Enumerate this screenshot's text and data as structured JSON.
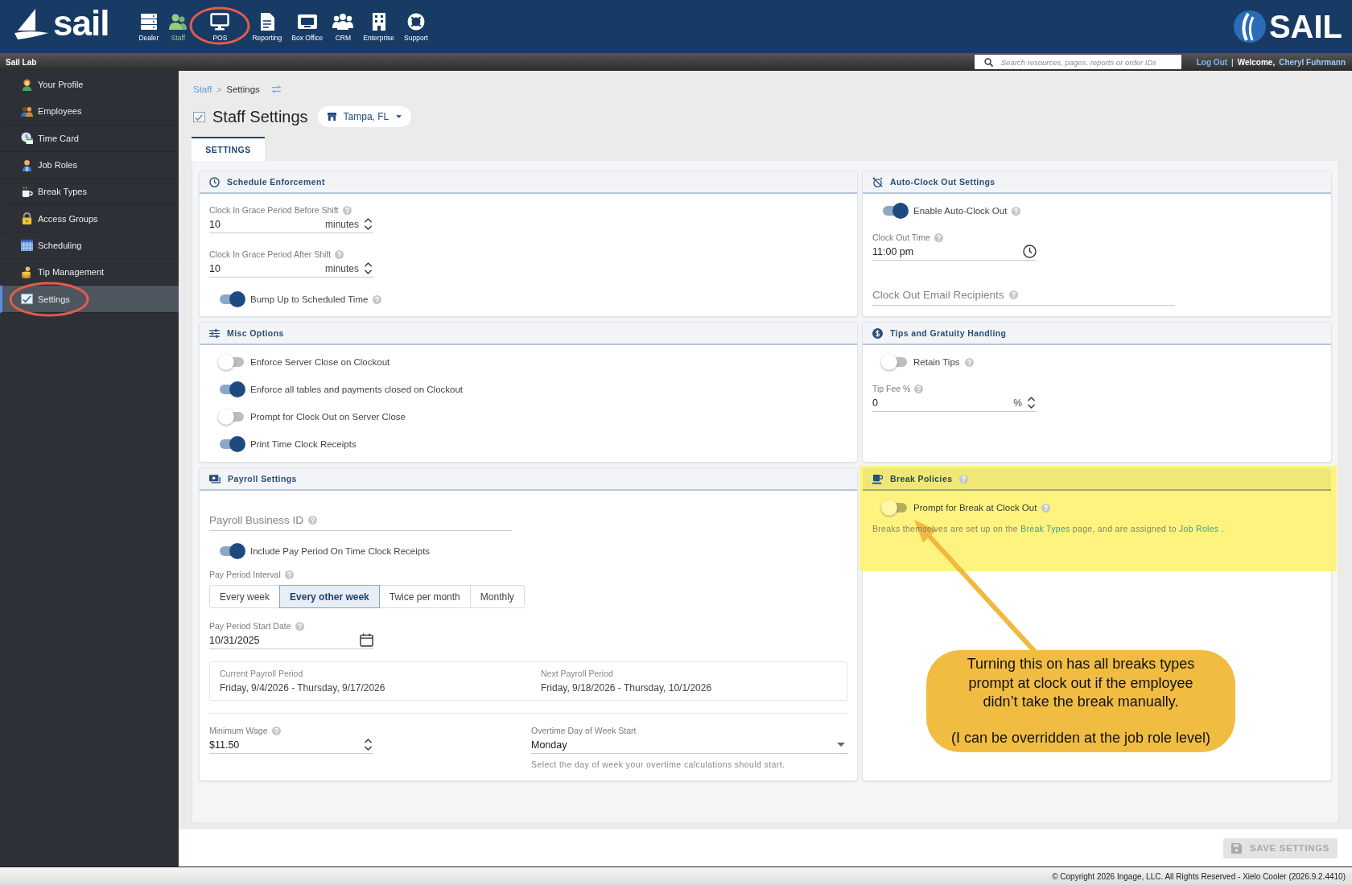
{
  "header": {
    "logo": "sail",
    "nav": [
      {
        "label": "Dealer",
        "selected": false,
        "circled": false
      },
      {
        "label": "Staff",
        "selected": true,
        "circled": false
      },
      {
        "label": "POS",
        "selected": false,
        "circled": true
      },
      {
        "label": "Reporting",
        "selected": false,
        "circled": false
      },
      {
        "label": "Box Office",
        "selected": false,
        "circled": false
      },
      {
        "label": "CRM",
        "selected": false,
        "circled": false
      },
      {
        "label": "Enterprise",
        "selected": false,
        "circled": false
      },
      {
        "label": "Support",
        "selected": false,
        "circled": false
      }
    ],
    "brand": "SAIL"
  },
  "toolbar": {
    "site": "Sail Lab",
    "search": {
      "placeholder": "Search resources, pages, reports or order IDs"
    },
    "logout": "Log Out",
    "separator": "|",
    "welcome": "Welcome,",
    "user": "Cheryl Fuhrmann"
  },
  "sidebar": {
    "items": [
      {
        "label": "Your Profile",
        "selected": false,
        "circled": false
      },
      {
        "label": "Employees",
        "selected": false,
        "circled": false
      },
      {
        "label": "Time Card",
        "selected": false,
        "circled": false
      },
      {
        "label": "Job Roles",
        "selected": false,
        "circled": false
      },
      {
        "label": "Break Types",
        "selected": false,
        "circled": false
      },
      {
        "label": "Access Groups",
        "selected": false,
        "circled": false
      },
      {
        "label": "Scheduling",
        "selected": false,
        "circled": false
      },
      {
        "label": "Tip Management",
        "selected": false,
        "circled": false
      },
      {
        "label": "Settings",
        "selected": true,
        "circled": true
      }
    ]
  },
  "breadcrumb": {
    "items": [
      {
        "label": "Staff",
        "link": true
      },
      {
        "label": "Settings",
        "link": false
      }
    ],
    "separator": ">"
  },
  "page": {
    "title": "Staff Settings",
    "location": "Tampa, FL"
  },
  "tabs": [
    {
      "label": "SETTINGS",
      "selected": true
    }
  ],
  "panels": [
    {
      "title": "Schedule Enforcement",
      "help": false,
      "highlighted": false,
      "rows": [
        {
          "kind": "number",
          "label": "Clock In Grace Period Before Shift",
          "help": true,
          "value": "10",
          "unit": "minutes"
        },
        {
          "kind": "number",
          "label": "Clock In Grace Period After Shift",
          "help": true,
          "value": "10",
          "unit": "minutes"
        },
        {
          "kind": "toggle",
          "label": "Bump Up to Scheduled Time",
          "help": true,
          "on": true
        }
      ]
    },
    {
      "title": "Auto-Clock Out Settings",
      "help": false,
      "highlighted": false,
      "rows": [
        {
          "kind": "toggle",
          "label": "Enable Auto-Clock Out",
          "help": true,
          "on": true
        },
        {
          "kind": "time",
          "label": "Clock Out Time",
          "help": true,
          "value": "11:00 pm"
        },
        {
          "kind": "empty",
          "placeholder": "Clock Out Email Recipients",
          "help": true
        }
      ]
    },
    {
      "title": "Misc Options",
      "help": false,
      "highlighted": false,
      "rows": [
        {
          "kind": "toggle",
          "label": "Enforce Server Close on Clockout",
          "help": false,
          "on": false
        },
        {
          "kind": "toggle",
          "label": "Enforce all tables and payments closed on Clockout",
          "help": false,
          "on": true
        },
        {
          "kind": "toggle",
          "label": "Prompt for Clock Out on Server Close",
          "help": false,
          "on": false
        },
        {
          "kind": "toggle",
          "label": "Print Time Clock Receipts",
          "help": false,
          "on": true
        }
      ]
    },
    {
      "title": "Tips and Gratuity Handling",
      "help": false,
      "highlighted": false,
      "rows": [
        {
          "kind": "toggle",
          "label": "Retain Tips",
          "help": true,
          "on": false
        },
        {
          "kind": "number",
          "label": "Tip Fee %",
          "help": true,
          "value": "0",
          "unit": "%"
        }
      ]
    },
    {
      "title": "Payroll Settings",
      "help": false,
      "highlighted": false,
      "rows": [
        {
          "kind": "empty",
          "placeholder": "Payroll Business ID",
          "help": true
        },
        {
          "kind": "toggle",
          "label": "Include Pay Period On Time Clock Receipts",
          "help": false,
          "on": true
        },
        {
          "kind": "segmented",
          "label": "Pay Period Interval",
          "help": true,
          "options": [
            {
              "label": "Every week",
              "selected": false
            },
            {
              "label": "Every other week",
              "selected": true
            },
            {
              "label": "Twice per month",
              "selected": false
            },
            {
              "label": "Monthly",
              "selected": false
            }
          ]
        },
        {
          "kind": "date",
          "label": "Pay Period Start Date",
          "help": true,
          "value": "10/31/2025"
        },
        {
          "kind": "summary",
          "items": [
            {
              "label": "Current Payroll Period",
              "value": "Friday, 9/4/2026 - Thursday, 9/17/2026"
            },
            {
              "label": "Next Payroll Period",
              "value": "Friday, 9/18/2026 - Thursday, 10/1/2026"
            }
          ]
        },
        {
          "kind": "pair",
          "fields": [
            {
              "kind": "number",
              "label": "Minimum Wage",
              "help": true,
              "value": "$11.50"
            },
            {
              "kind": "select",
              "label": "Overtime Day of Week Start",
              "help": false,
              "value": "Monday",
              "hint": "Select the day of week your overtime calculations should start."
            }
          ]
        }
      ]
    },
    {
      "title": "Break Policies",
      "help": true,
      "highlighted": true,
      "rows": [
        {
          "kind": "toggle",
          "label": "Prompt for Break at Clock Out",
          "help": true,
          "on": false
        },
        {
          "kind": "note",
          "parts": [
            {
              "text": "Breaks themselves are set up on the",
              "link": false
            },
            {
              "text": "Break Types",
              "link": true
            },
            {
              "text": "page, and are assigned to",
              "link": false
            },
            {
              "text": "Job Roles",
              "link": true
            },
            {
              "text": ".",
              "link": false
            }
          ]
        }
      ]
    }
  ],
  "save_button": {
    "label": "SAVE SETTINGS",
    "disabled": true
  },
  "footer": "© Copyright 2026 Ingage, LLC. All Rights Reserved - Xielo Cooler (2026.9.2.4410)",
  "callout": {
    "paragraphs": [
      "Turning this on has all breaks types prompt at clock out if the employee didn’t take the break manually.",
      "(I can be overridden at the job role level)"
    ]
  }
}
